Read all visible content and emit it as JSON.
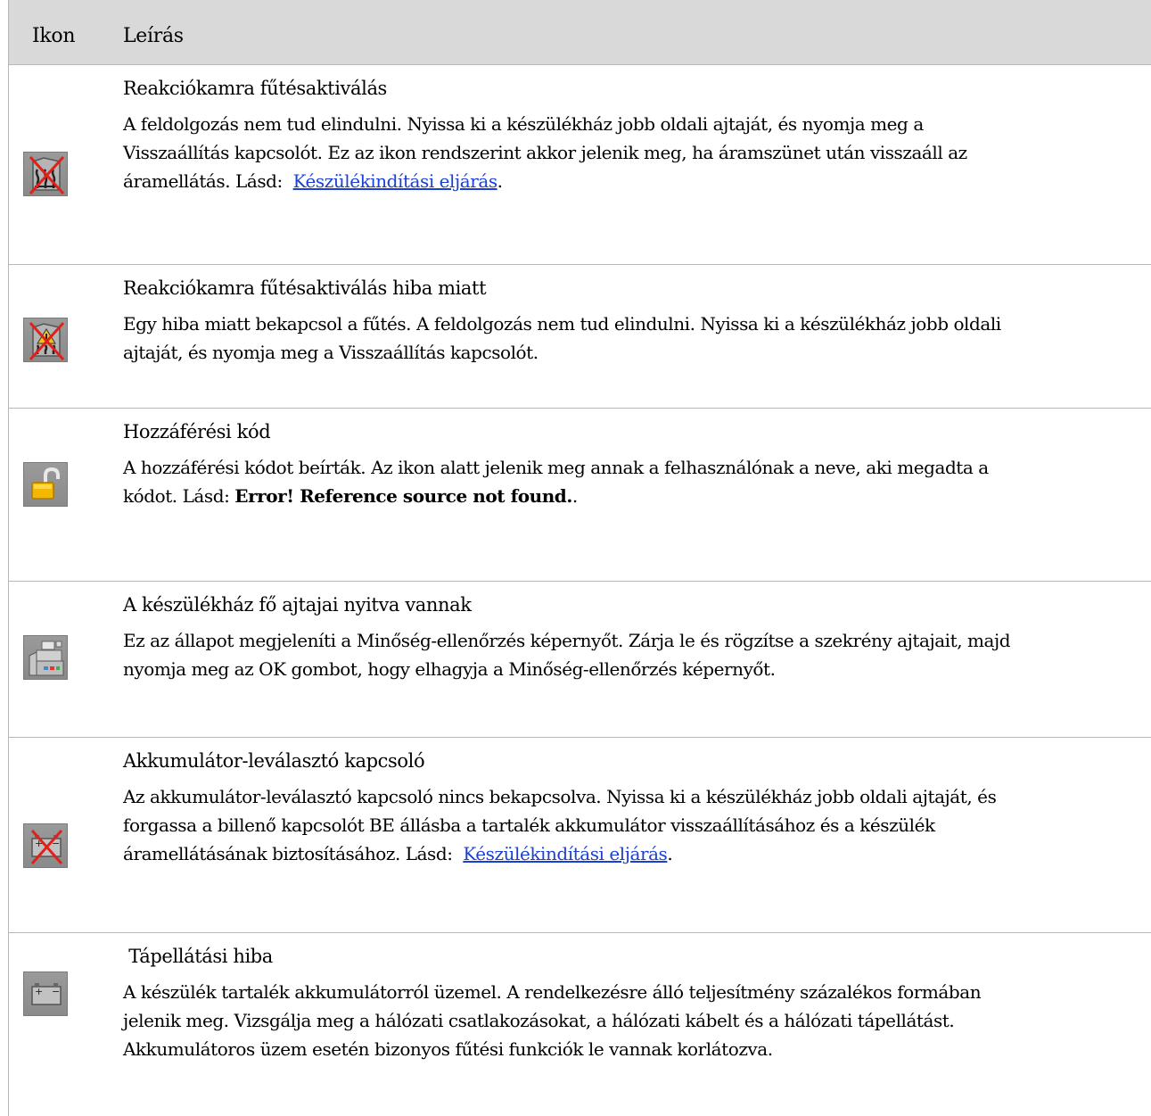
{
  "header": {
    "col_icon": "Ikon",
    "col_desc": "Leírás"
  },
  "rows": [
    {
      "icon": "heater-disabled-icon",
      "title": "Reakciókamra fűtésaktiválás",
      "line1": "A feldolgozás nem tud elindulni. Nyissa ki a készülékház jobb oldali ajtaját, és nyomja meg a",
      "line2": "Visszaállítás kapcsolót. Ez az ikon rendszerint akkor jelenik meg, ha áramszünet után visszaáll az",
      "line3_pre": "áramellátás. Lásd:  ",
      "line3_link": "Készülékindítási eljárás",
      "line3_post": "."
    },
    {
      "icon": "heater-fault-icon",
      "title": "Reakciókamra fűtésaktiválás hiba miatt",
      "line1": "Egy hiba miatt bekapcsol a fűtés. A feldolgozás nem tud elindulni. Nyissa ki a készülékház jobb oldali",
      "line2": "ajtaját, és nyomja meg a Visszaállítás kapcsolót."
    },
    {
      "icon": "padlock-open-icon",
      "title": "Hozzáférési kód",
      "line1": "A hozzáférési kódot beírták. Az ikon alatt jelenik meg annak a felhasználónak a neve, aki megadta a",
      "line2_pre": "kódot. Lásd: ",
      "line2_bold": "Error! Reference source not found.",
      "line2_post": "."
    },
    {
      "icon": "cabinet-doors-open-icon",
      "title": "A készülékház fő ajtajai nyitva vannak",
      "line1": "Ez az állapot megjeleníti a Minőség-ellenőrzés képernyőt. Zárja le és rögzítse a szekrény ajtajait, majd",
      "line2": "nyomja meg az OK gombot, hogy elhagyja a Minőség-ellenőrzés képernyőt."
    },
    {
      "icon": "battery-disconnected-icon",
      "title": "Akkumulátor-leválasztó kapcsoló",
      "line1": "Az akkumulátor-leválasztó kapcsoló nincs bekapcsolva. Nyissa ki a készülékház jobb oldali ajtaját, és",
      "line2": "forgassa a billenő kapcsolót BE állásba a tartalék akkumulátor visszaállításához és a készülék",
      "line3_pre": "áramellátásának biztosításához. Lásd:  ",
      "line3_link": "Készülékindítási eljárás",
      "line3_post": "."
    },
    {
      "icon": "battery-icon",
      "title": " Tápellátási hiba",
      "line1": "A készülék tartalék akkumulátorról üzemel. A rendelkezésre álló teljesítmény százalékos formában",
      "line2": "jelenik meg. Vizsgálja meg a hálózati csatlakozásokat, a hálózati kábelt és a hálózati tápellátást.",
      "line3": "Akkumulátoros üzem esetén bizonyos fűtési funkciók le vannak korlátozva."
    }
  ]
}
